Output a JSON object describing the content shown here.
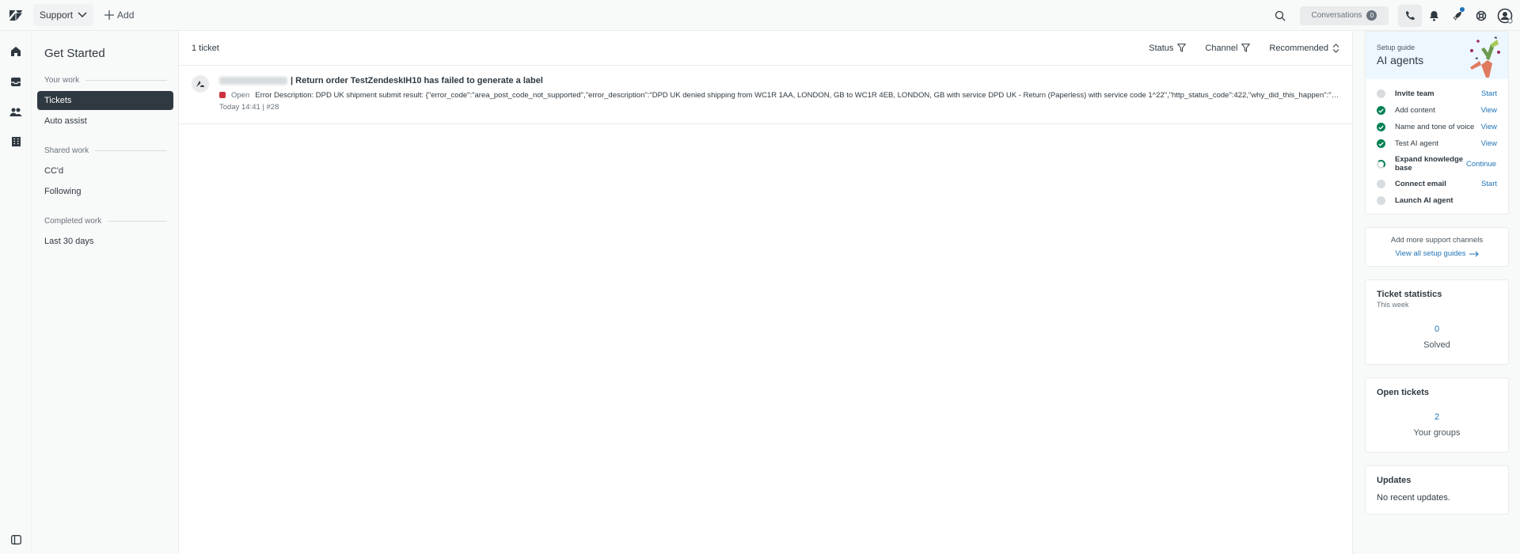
{
  "topbar": {
    "product_label": "Support",
    "add_label": "Add",
    "conversations_label": "Conversations",
    "conversations_count": "0"
  },
  "views": {
    "title": "Get Started",
    "groups": [
      {
        "heading": "Your work",
        "items": [
          "Tickets",
          "Auto assist"
        ]
      },
      {
        "heading": "Shared work",
        "items": [
          "CC'd",
          "Following"
        ]
      },
      {
        "heading": "Completed work",
        "items": [
          "Last 30 days"
        ]
      }
    ]
  },
  "main": {
    "ticket_count": "1 ticket",
    "filters": {
      "status": "Status",
      "channel": "Channel",
      "sort": "Recommended"
    },
    "ticket": {
      "title": "| Return order TestZendeskIH10 has failed to generate a label",
      "status": "Open",
      "description": "Error Description: DPD UK shipment submit result: {\"error_code\":\"area_post_code_not_supported\",\"error_description\":\"DPD UK denied shipping from WC1R 1AA, LONDON, GB to WC1R 4EB, LONDON, GB with service DPD UK - Return (Paperless) with service code 1^22\",\"http_status_code\":422,\"why_did_this_happen\":\"DPD UK denied ship...",
      "time": "Today 14:41 | #28"
    }
  },
  "guide": {
    "subtitle": "Setup guide",
    "title": "AI agents",
    "steps": [
      {
        "label": "Invite team",
        "action": "Start",
        "state": "todo"
      },
      {
        "label": "Add content",
        "action": "View",
        "state": "done"
      },
      {
        "label": "Name and tone of voice",
        "action": "View",
        "state": "done"
      },
      {
        "label": "Test AI agent",
        "action": "View",
        "state": "done"
      },
      {
        "label": "Expand knowledge base",
        "action": "Continue",
        "state": "prog"
      },
      {
        "label": "Connect email",
        "action": "Start",
        "state": "todo"
      },
      {
        "label": "Launch AI agent",
        "action": "",
        "state": "todo"
      }
    ]
  },
  "channels": {
    "text": "Add more support channels",
    "link": "View all setup guides"
  },
  "ticket_stats": {
    "title": "Ticket statistics",
    "subtitle": "This week",
    "value": "0",
    "label": "Solved"
  },
  "open_tickets": {
    "title": "Open tickets",
    "value": "2",
    "label": "Your groups"
  },
  "updates": {
    "title": "Updates",
    "text": "No recent updates."
  },
  "colors": {
    "accent": "#1f73b7",
    "success": "#038153",
    "danger": "#cc3340",
    "dark": "#2f3941"
  }
}
